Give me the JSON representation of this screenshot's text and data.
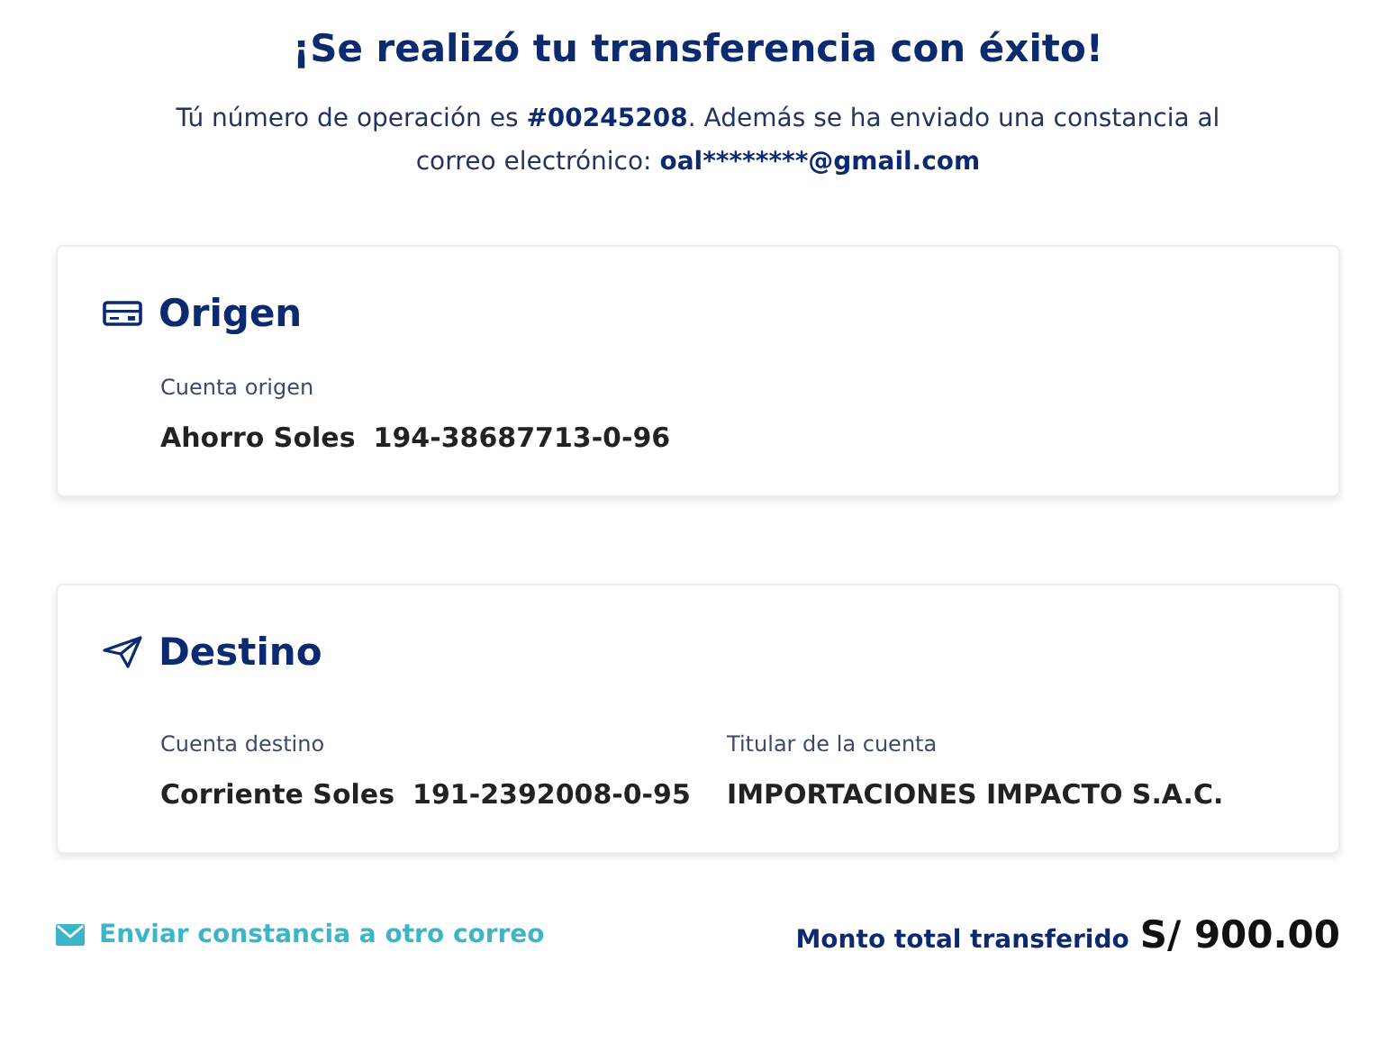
{
  "title": "¡Se realizó tu transferencia con éxito!",
  "message": {
    "intro": "Tú número de operación es ",
    "operation_number": "#00245208",
    "middle": ". Además se ha enviado una constancia al correo electrónico: ",
    "email": "oal********@gmail.com"
  },
  "sections": [
    {
      "kind": "card",
      "title": "Origen",
      "fields": [
        {
          "label": "Cuenta origen",
          "account_type": "Ahorro Soles",
          "number": "194-38687713-0-96"
        }
      ]
    },
    {
      "kind": "plane",
      "title": "Destino",
      "fields": [
        {
          "label": "Cuenta destino",
          "account_type": "Corriente Soles",
          "number": "191-2392008-0-95"
        },
        {
          "label": "Titular de la cuenta",
          "value": "IMPORTACIONES IMPACTO S.A.C."
        }
      ]
    }
  ],
  "footer": {
    "link": "Enviar constancia a otro correo",
    "total_label": "Monto total transferido",
    "total": "S/ 900.00"
  }
}
